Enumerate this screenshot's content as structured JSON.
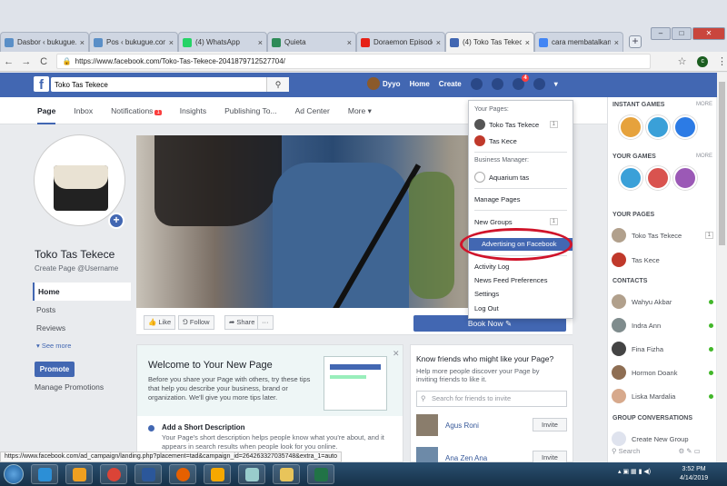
{
  "browser": {
    "tabs": [
      {
        "title": "Dasbor ‹ bukugue.com",
        "color": "#5a8fc7"
      },
      {
        "title": "Pos ‹ bukugue.com",
        "color": "#5a8fc7"
      },
      {
        "title": "(4) WhatsApp",
        "color": "#25d366"
      },
      {
        "title": "Quieta",
        "color": "#2e8b57"
      },
      {
        "title": "Doraemon Episode",
        "color": "#e62117"
      },
      {
        "title": "(4) Toko Tas Tekece",
        "color": "#4267b2"
      },
      {
        "title": "cara membatalkan",
        "color": "#4285f4"
      }
    ],
    "url": "https://www.facebook.com/Toko-Tas-Tekece-2041879712527704/",
    "url_prefix": "Secure"
  },
  "fb": {
    "search_value": "Toko Tas Tekece",
    "user": "Dyyo",
    "home": "Home",
    "create": "Create",
    "notif_count": "4"
  },
  "pagenav": [
    "Page",
    "Inbox",
    "Notifications",
    "Insights",
    "Publishing To...",
    "Ad Center",
    "More ▾"
  ],
  "pagenav_badge": "1",
  "page": {
    "name": "Toko Tas Tekece",
    "username": "Create Page @Username",
    "left_nav": [
      "Home",
      "Posts",
      "Reviews"
    ],
    "see_more": "▾ See more",
    "promote": "Promote",
    "manage": "Manage Promotions"
  },
  "actions": {
    "like": "👍 Like",
    "follow": "⅁ Follow",
    "share": "➦ Share",
    "more": "···",
    "book_now": "Book Now ✎"
  },
  "welcome": {
    "title": "Welcome to Your New Page",
    "desc": "Before you share your Page with others, try these tips that help you describe your business, brand or organization. We'll give you more tips later.",
    "step_title": "Add a Short Description",
    "step_desc": "Your Page's short description helps people know what you're about, and it appears in search results when people look for you online."
  },
  "friends": {
    "title": "Know friends who might like your Page?",
    "desc": "Help more people discover your Page by inviting friends to like it.",
    "search_placeholder": "Search for friends to invite",
    "list": [
      {
        "name": "Agus Roni",
        "action": "Invite"
      },
      {
        "name": "Ana Zen Ana",
        "action": "Invite"
      }
    ]
  },
  "dropdown": {
    "your_pages": "Your Pages:",
    "pages": [
      {
        "name": "Toko Tas Tekece",
        "count": "1"
      },
      {
        "name": "Tas Kece",
        "count": ""
      }
    ],
    "business_manager": "Business Manager:",
    "business": "Aquarium tas",
    "items_top": [
      "Manage Pages",
      "New Groups"
    ],
    "new_groups_count": "1",
    "highlighted": "Advertising on Facebook",
    "items_bottom": [
      "Activity Log",
      "News Feed Preferences",
      "Settings",
      "Log Out"
    ]
  },
  "sidebar": {
    "instant_games": "INSTANT GAMES",
    "more": "MORE",
    "your_games": "YOUR GAMES",
    "your_pages": "YOUR PAGES",
    "pages": [
      {
        "name": "Toko Tas Tekece",
        "count": "1"
      },
      {
        "name": "Tas Kece",
        "count": ""
      }
    ],
    "contacts_label": "CONTACTS",
    "contacts": [
      "Wahyu Akbar",
      "Indra Ann",
      "Fina Fizha",
      "Hormon Doank",
      "Liska Mardalia"
    ],
    "group_conv": "GROUP CONVERSATIONS",
    "create_group": "Create New Group",
    "search": "Search"
  },
  "status_url": "https://www.facebook.com/ad_campaign/landing.php?placement=tad&campaign_id=264263327035748&extra_1=auto",
  "taskbar": {
    "time": "3:52 PM",
    "date": "4/14/2019"
  }
}
